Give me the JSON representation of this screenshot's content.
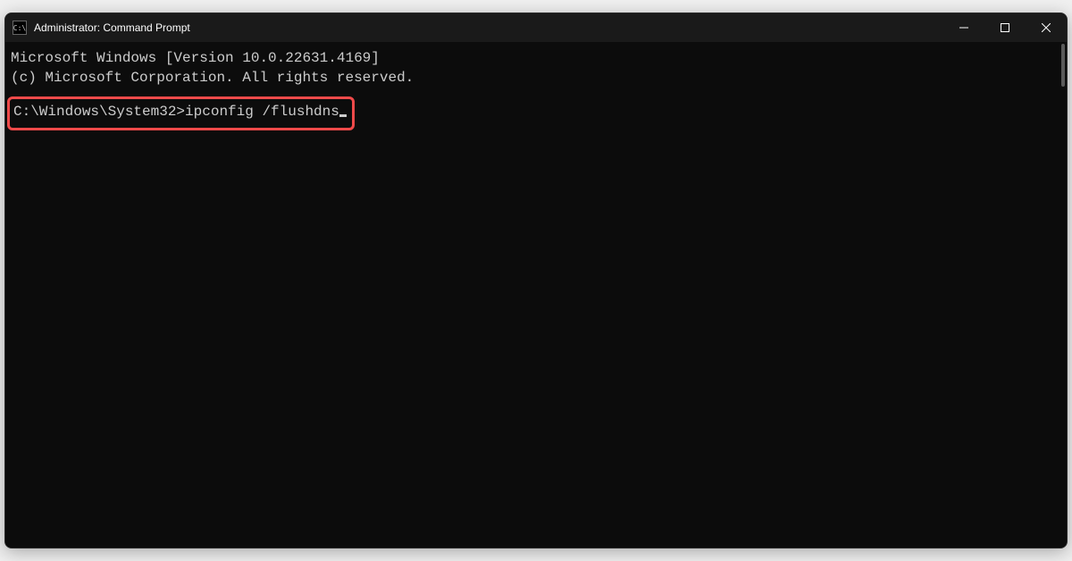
{
  "titlebar": {
    "icon_glyph": "C:\\",
    "title": "Administrator: Command Prompt"
  },
  "terminal": {
    "banner_line1": "Microsoft Windows [Version 10.0.22631.4169]",
    "banner_line2": "(c) Microsoft Corporation. All rights reserved.",
    "prompt": "C:\\Windows\\System32>",
    "command": "ipconfig /flushdns"
  },
  "annotations": {
    "highlight_color": "#f04a4a"
  }
}
